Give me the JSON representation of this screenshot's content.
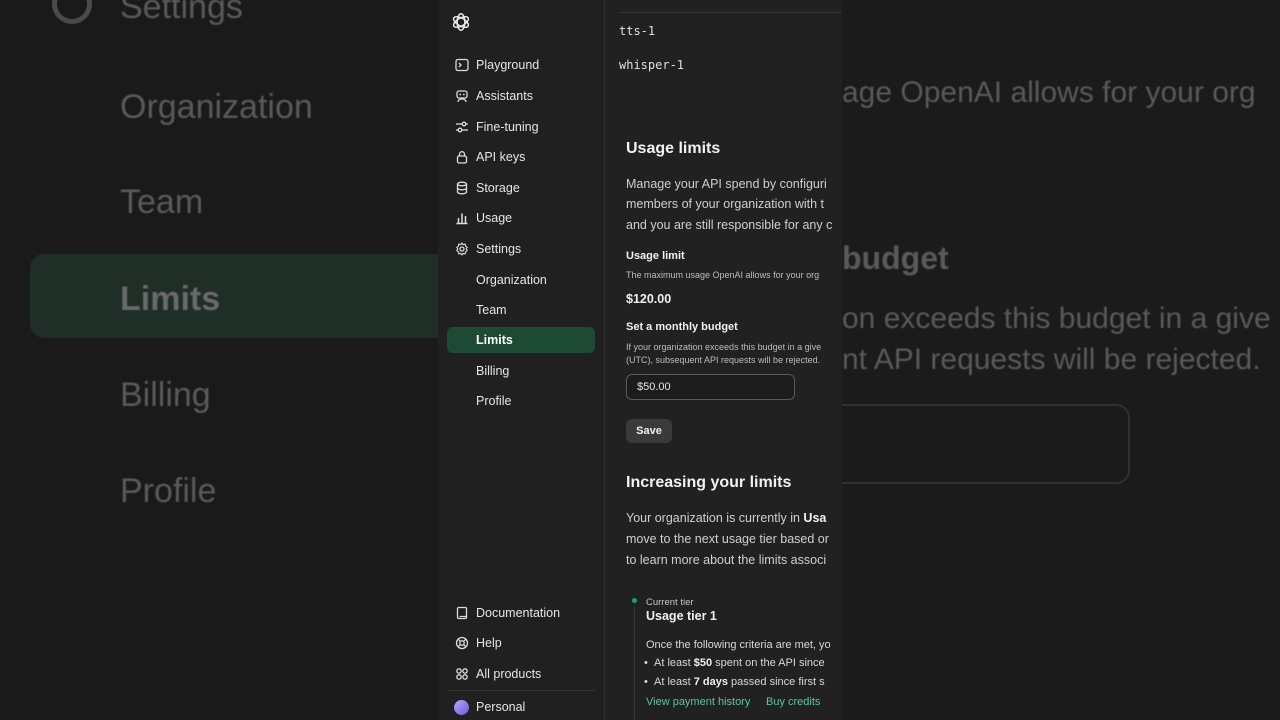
{
  "background": {
    "left_items": [
      "Settings",
      "Organization",
      "Team",
      "Limits",
      "Billing",
      "Profile"
    ],
    "right_lines": [
      "age OpenAI allows for your org",
      "budget",
      "on exceeds this budget in a give",
      "nt API requests will be rejected."
    ]
  },
  "sidebar": {
    "nav": [
      {
        "label": "Playground",
        "icon": "terminal-icon"
      },
      {
        "label": "Assistants",
        "icon": "robot-icon"
      },
      {
        "label": "Fine-tuning",
        "icon": "sliders-icon"
      },
      {
        "label": "API keys",
        "icon": "lock-icon"
      },
      {
        "label": "Storage",
        "icon": "database-icon"
      },
      {
        "label": "Usage",
        "icon": "bar-chart-icon"
      },
      {
        "label": "Settings",
        "icon": "gear-icon"
      }
    ],
    "settings_sub": [
      "Organization",
      "Team",
      "Limits",
      "Billing",
      "Profile"
    ],
    "bottom": [
      {
        "label": "Documentation",
        "icon": "book-icon"
      },
      {
        "label": "Help",
        "icon": "lifebuoy-icon"
      },
      {
        "label": "All products",
        "icon": "grid-icon"
      }
    ],
    "personal": "Personal"
  },
  "models": [
    "tts-1",
    "whisper-1"
  ],
  "usage_limits": {
    "title": "Usage limits",
    "desc_lines": [
      "Manage your API spend by configuri",
      "members of your organization with t",
      "and you are still responsible for any c"
    ],
    "usage_limit_label": "Usage limit",
    "usage_limit_desc": "The maximum usage OpenAI allows for your org",
    "usage_limit_value": "$120.00",
    "budget_label": "Set a monthly budget",
    "budget_desc_lines": [
      "If your organization exceeds this budget in a give",
      "(UTC), subsequent API requests will be rejected."
    ],
    "budget_value": "$50.00",
    "save_label": "Save"
  },
  "increasing": {
    "title": "Increasing your limits",
    "desc_line1_prefix": "Your organization is currently in ",
    "desc_line1_bold": "Usa",
    "desc_lines": [
      "move to the next usage tier based or",
      "to learn more about the limits associ"
    ],
    "tier_caption": "Current tier",
    "tier_name": "Usage tier 1",
    "criteria": "Once the following criteria are met, yo",
    "bullets": [
      {
        "prefix": "At least ",
        "bold": "$50",
        "suffix": " spent on the API since"
      },
      {
        "prefix": "At least ",
        "bold": "7 days",
        "suffix": " passed since first s"
      }
    ],
    "links": [
      "View payment history",
      "Buy credits"
    ]
  }
}
